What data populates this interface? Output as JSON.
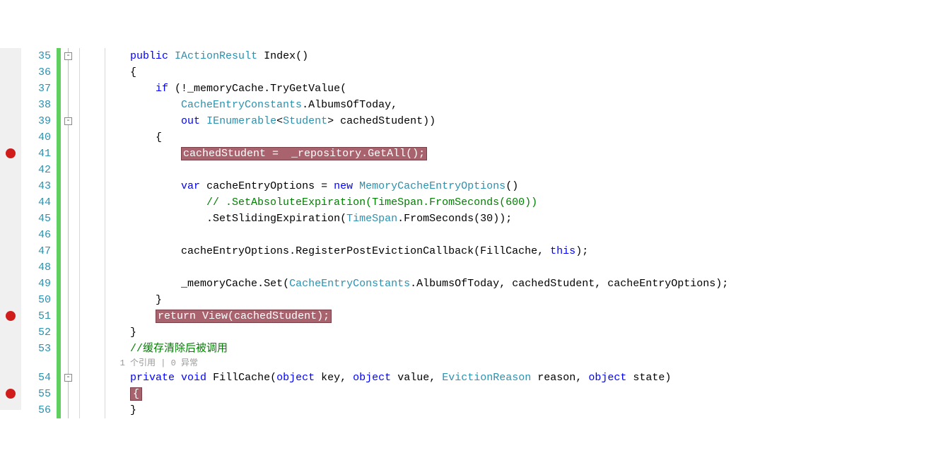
{
  "breakpoints": [
    41,
    51,
    55
  ],
  "line_start": 35,
  "line_end": 56,
  "fold_lines": [
    35,
    39,
    54
  ],
  "codelens": {
    "refs": "1 个引用",
    "sep": " | ",
    "exc": "0 异常"
  },
  "code": {
    "35": {
      "indent": 2,
      "tokens": [
        [
          "kw",
          "public"
        ],
        [
          "punc",
          " "
        ],
        [
          "type",
          "IActionResult"
        ],
        [
          "punc",
          " "
        ],
        [
          "ident",
          "Index"
        ],
        [
          "punc",
          "()"
        ]
      ]
    },
    "36": {
      "indent": 2,
      "tokens": [
        [
          "punc",
          "{"
        ]
      ]
    },
    "37": {
      "indent": 3,
      "tokens": [
        [
          "kw",
          "if"
        ],
        [
          "punc",
          " (!_memoryCache."
        ],
        [
          "ident",
          "TryGetValue"
        ],
        [
          "punc",
          "("
        ]
      ]
    },
    "38": {
      "indent": 4,
      "tokens": [
        [
          "type",
          "CacheEntryConstants"
        ],
        [
          "punc",
          "."
        ],
        [
          "ident",
          "AlbumsOfToday"
        ],
        [
          "punc",
          ","
        ]
      ]
    },
    "39": {
      "indent": 4,
      "tokens": [
        [
          "kw",
          "out"
        ],
        [
          "punc",
          " "
        ],
        [
          "type",
          "IEnumerable"
        ],
        [
          "punc",
          "<"
        ],
        [
          "type",
          "Student"
        ],
        [
          "punc",
          "> "
        ],
        [
          "ident",
          "cachedStudent"
        ],
        [
          "punc",
          "))"
        ]
      ]
    },
    "40": {
      "indent": 3,
      "tokens": [
        [
          "punc",
          "{"
        ]
      ]
    },
    "41": {
      "indent": 4,
      "tokens": [
        [
          "hl",
          "cachedStudent =  _repository.GetAll();"
        ]
      ]
    },
    "42": {
      "indent": 0,
      "tokens": []
    },
    "43": {
      "indent": 4,
      "tokens": [
        [
          "kw",
          "var"
        ],
        [
          "punc",
          " "
        ],
        [
          "ident",
          "cacheEntryOptions"
        ],
        [
          "punc",
          " = "
        ],
        [
          "kw",
          "new"
        ],
        [
          "punc",
          " "
        ],
        [
          "type",
          "MemoryCacheEntryOptions"
        ],
        [
          "punc",
          "()"
        ]
      ]
    },
    "44": {
      "indent": 5,
      "tokens": [
        [
          "comment",
          "// .SetAbsoluteExpiration(TimeSpan.FromSeconds(600))"
        ]
      ]
    },
    "45": {
      "indent": 5,
      "tokens": [
        [
          "punc",
          "."
        ],
        [
          "ident",
          "SetSlidingExpiration"
        ],
        [
          "punc",
          "("
        ],
        [
          "type",
          "TimeSpan"
        ],
        [
          "punc",
          "."
        ],
        [
          "ident",
          "FromSeconds"
        ],
        [
          "punc",
          "("
        ],
        [
          "num",
          "30"
        ],
        [
          "punc",
          "));"
        ]
      ]
    },
    "46": {
      "indent": 0,
      "tokens": []
    },
    "47": {
      "indent": 4,
      "tokens": [
        [
          "ident",
          "cacheEntryOptions"
        ],
        [
          "punc",
          "."
        ],
        [
          "ident",
          "RegisterPostEvictionCallback"
        ],
        [
          "punc",
          "("
        ],
        [
          "ident",
          "FillCache"
        ],
        [
          "punc",
          ", "
        ],
        [
          "kw",
          "this"
        ],
        [
          "punc",
          ");"
        ]
      ]
    },
    "48": {
      "indent": 0,
      "tokens": []
    },
    "49": {
      "indent": 4,
      "tokens": [
        [
          "ident",
          "_memoryCache"
        ],
        [
          "punc",
          "."
        ],
        [
          "ident",
          "Set"
        ],
        [
          "punc",
          "("
        ],
        [
          "type",
          "CacheEntryConstants"
        ],
        [
          "punc",
          "."
        ],
        [
          "ident",
          "AlbumsOfToday"
        ],
        [
          "punc",
          ", "
        ],
        [
          "ident",
          "cachedStudent"
        ],
        [
          "punc",
          ", "
        ],
        [
          "ident",
          "cacheEntryOptions"
        ],
        [
          "punc",
          ");"
        ]
      ]
    },
    "50": {
      "indent": 3,
      "tokens": [
        [
          "punc",
          "}"
        ]
      ]
    },
    "51": {
      "indent": 3,
      "tokens": [
        [
          "hl",
          "return View(cachedStudent);"
        ]
      ]
    },
    "52": {
      "indent": 2,
      "tokens": [
        [
          "punc",
          "}"
        ]
      ]
    },
    "53": {
      "indent": 2,
      "tokens": [
        [
          "comment",
          "//缓存清除后被调用"
        ]
      ]
    },
    "54": {
      "indent": 2,
      "tokens": [
        [
          "kw",
          "private"
        ],
        [
          "punc",
          " "
        ],
        [
          "kw",
          "void"
        ],
        [
          "punc",
          " "
        ],
        [
          "ident",
          "FillCache"
        ],
        [
          "punc",
          "("
        ],
        [
          "kw",
          "object"
        ],
        [
          "punc",
          " "
        ],
        [
          "ident",
          "key"
        ],
        [
          "punc",
          ", "
        ],
        [
          "kw",
          "object"
        ],
        [
          "punc",
          " "
        ],
        [
          "ident",
          "value"
        ],
        [
          "punc",
          ", "
        ],
        [
          "type",
          "EvictionReason"
        ],
        [
          "punc",
          " "
        ],
        [
          "ident",
          "reason"
        ],
        [
          "punc",
          ", "
        ],
        [
          "kw",
          "object"
        ],
        [
          "punc",
          " "
        ],
        [
          "ident",
          "state"
        ],
        [
          "punc",
          ")"
        ]
      ]
    },
    "55": {
      "indent": 2,
      "tokens": [
        [
          "hl-brace",
          "{"
        ]
      ]
    },
    "56": {
      "indent": 2,
      "tokens": [
        [
          "punc",
          "}"
        ]
      ]
    }
  },
  "change_bars": [
    {
      "from": 35,
      "to": 56
    }
  ],
  "indent_guides": [
    {
      "col": 0,
      "from": 35,
      "to": 56
    },
    {
      "col": 1,
      "from": 35,
      "to": 56
    }
  ],
  "indent_unit": "    "
}
